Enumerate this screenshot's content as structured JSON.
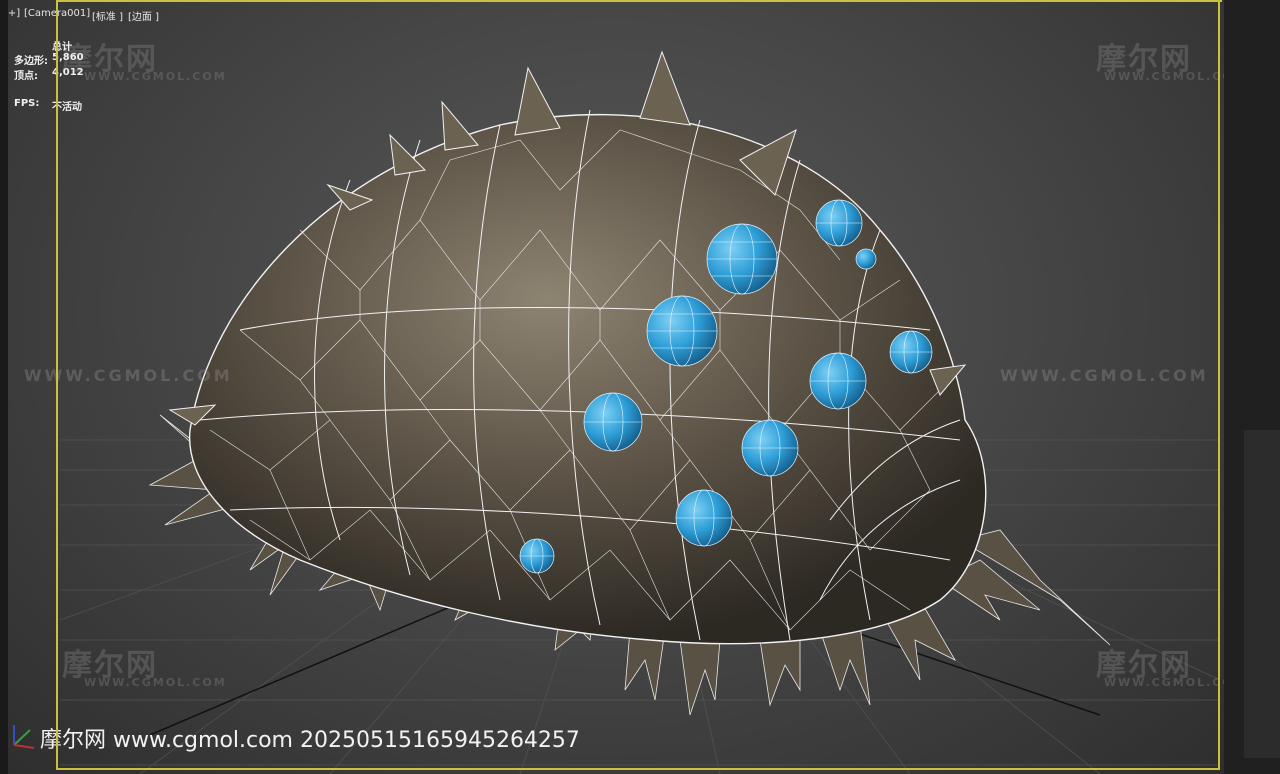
{
  "viewport": {
    "label_plus": "[+]",
    "label_camera": "[Camera001]",
    "label_shading": "[标准 ]",
    "label_edged": "[边面 ]"
  },
  "stats": {
    "total_label": "总计",
    "polygons_label": "多边形:",
    "polygons_value": "5,860",
    "vertices_label": "顶点:",
    "vertices_value": "4,012",
    "fps_label": "FPS:",
    "fps_value": "不活动"
  },
  "watermarks": {
    "brand": "摩尔网",
    "domain_small": "WWW.CGMOL.COM",
    "domain_line": "WWW.CGMOL.COM",
    "footer": "摩尔网 www.cgmol.com 20250515165945264257"
  },
  "colors": {
    "frame_accent": "#c8c23c",
    "eye_blue": "#2f9fd8",
    "carapace": "#5e5548"
  }
}
